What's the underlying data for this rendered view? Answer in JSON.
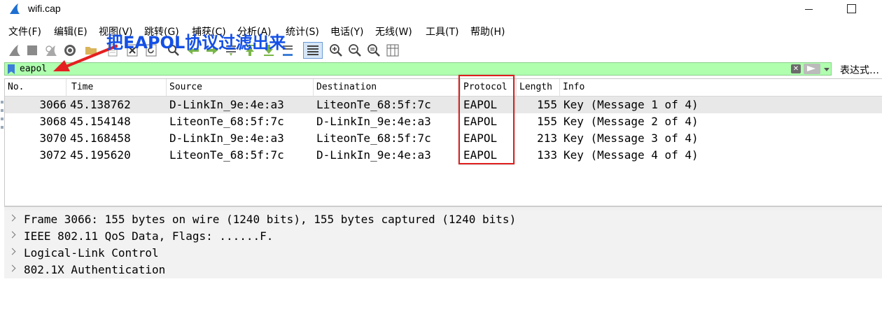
{
  "window": {
    "title": "wifi.cap",
    "minimize_glyph": "",
    "maximize_glyph": ""
  },
  "menu": [
    "文件(F)",
    "编辑(E)",
    "视图(V)",
    "跳转(G)",
    "捕获(C)",
    "分析(A)",
    "统计(S)",
    "电话(Y)",
    "无线(W)",
    "工具(T)",
    "帮助(H)"
  ],
  "toolbar_icons": [
    "shark-fin-start-icon",
    "stop-square-icon",
    "restart-fin-icon",
    "capture-options-gear-icon",
    "open-folder-icon",
    "file-icon",
    "close-file-icon",
    "reload-icon",
    "find-magnifier-icon",
    "go-back-arrow-icon",
    "go-forward-arrow-icon",
    "go-to-packet-icon",
    "first-packet-icon",
    "last-packet-icon",
    "auto-scroll-icon",
    "colorize-icon",
    "zoom-in-icon",
    "zoom-out-icon",
    "normal-size-icon",
    "resize-columns-icon"
  ],
  "filter": {
    "value": "eapol",
    "clear_glyph": "✕",
    "expression_label": "表达式…"
  },
  "annotation": {
    "text": "把EAPOL协议过滤出来"
  },
  "columns": [
    "No.",
    "Time",
    "Source",
    "Destination",
    "Protocol",
    "Length",
    "Info"
  ],
  "packets": [
    {
      "no": "3066",
      "time": "45.138762",
      "source": "D-LinkIn_9e:4e:a3",
      "destination": "LiteonTe_68:5f:7c",
      "protocol": "EAPOL",
      "length": "155",
      "info": "Key (Message 1 of 4)"
    },
    {
      "no": "3068",
      "time": "45.154148",
      "source": "LiteonTe_68:5f:7c",
      "destination": "D-LinkIn_9e:4e:a3",
      "protocol": "EAPOL",
      "length": "155",
      "info": "Key (Message 2 of 4)"
    },
    {
      "no": "3070",
      "time": "45.168458",
      "source": "D-LinkIn_9e:4e:a3",
      "destination": "LiteonTe_68:5f:7c",
      "protocol": "EAPOL",
      "length": "213",
      "info": "Key (Message 3 of 4)"
    },
    {
      "no": "3072",
      "time": "45.195620",
      "source": "LiteonTe_68:5f:7c",
      "destination": "D-LinkIn_9e:4e:a3",
      "protocol": "EAPOL",
      "length": "133",
      "info": "Key (Message 4 of 4)"
    }
  ],
  "details": [
    "Frame 3066: 155 bytes on wire (1240 bits), 155 bytes captured (1240 bits)",
    "IEEE 802.11 QoS Data, Flags: ......F.",
    "Logical-Link Control",
    "802.1X Authentication"
  ],
  "colors": {
    "filter_valid_bg": "#afffaf",
    "selected_row_bg": "#e8e8e8",
    "highlight_box": "#e02020",
    "annotation_text": "#1450e6",
    "annotation_arrow": "#e52020"
  }
}
